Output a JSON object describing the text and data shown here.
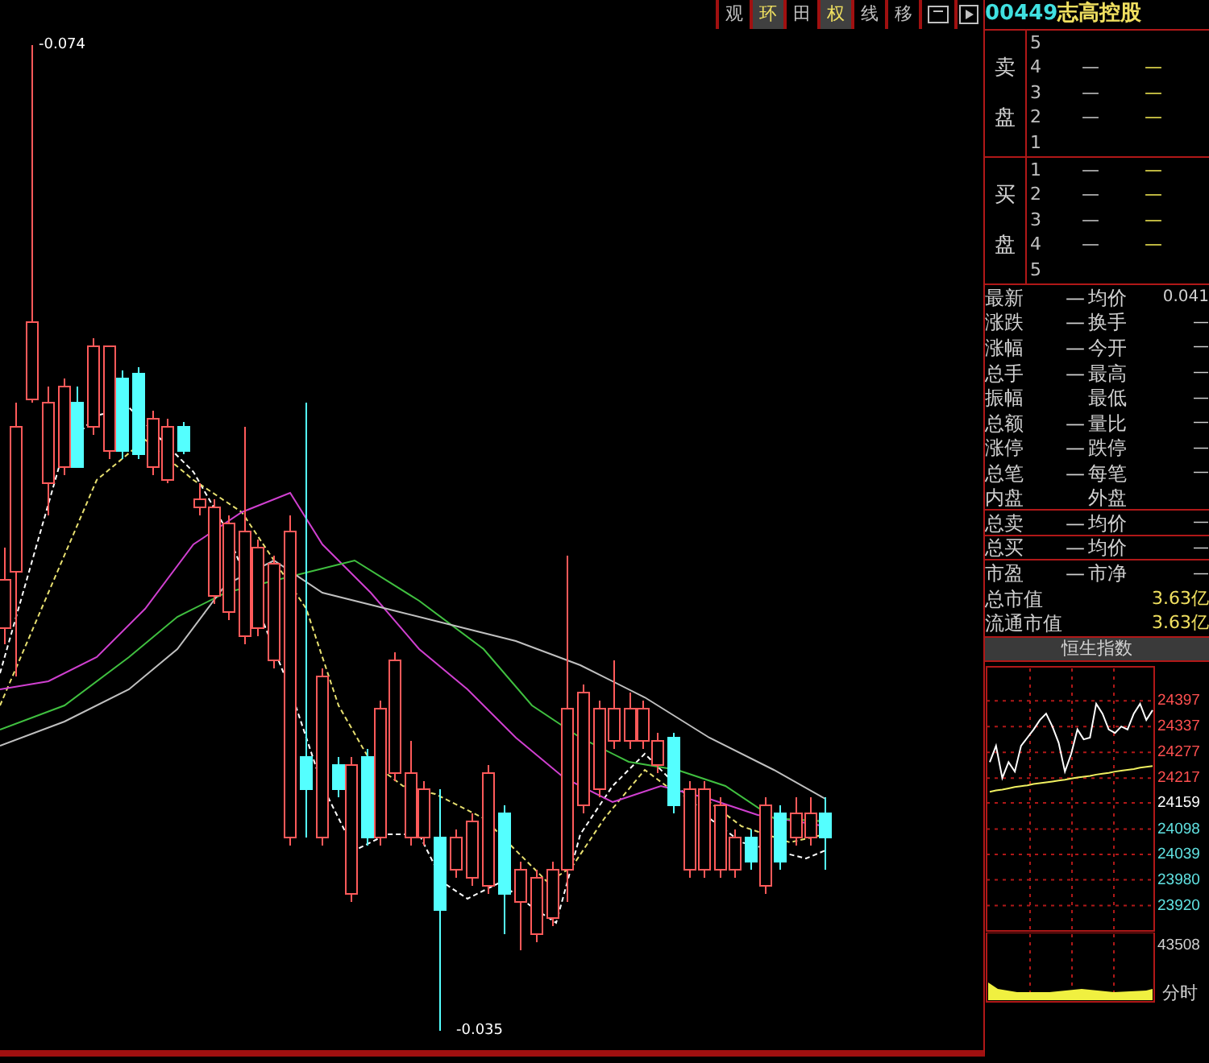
{
  "toolbar": {
    "buttons": [
      {
        "label": "观",
        "selected": false
      },
      {
        "label": "环",
        "selected": true
      },
      {
        "label": "田",
        "selected": false
      },
      {
        "label": "权",
        "selected": true
      },
      {
        "label": "线",
        "selected": false
      },
      {
        "label": "移",
        "selected": false
      }
    ]
  },
  "quote": {
    "code": "00449",
    "name": "志高控股"
  },
  "chart": {
    "high_label": "-0.074",
    "low_label": "-0.035"
  },
  "order_book": {
    "sell_label": [
      "卖",
      "盘"
    ],
    "buy_label": [
      "买",
      "盘"
    ],
    "sell": [
      {
        "level": "5"
      },
      {
        "level": "4",
        "price": "—",
        "volume": "—"
      },
      {
        "level": "3",
        "price": "—",
        "volume": "—"
      },
      {
        "level": "2",
        "price": "—",
        "volume": "—"
      },
      {
        "level": "1"
      }
    ],
    "buy": [
      {
        "level": "1",
        "price": "—",
        "volume": "—"
      },
      {
        "level": "2",
        "price": "—",
        "volume": "—"
      },
      {
        "level": "3",
        "price": "—",
        "volume": "—"
      },
      {
        "level": "4",
        "price": "—",
        "volume": "—"
      },
      {
        "level": "5"
      }
    ]
  },
  "stats": [
    {
      "label": "最新",
      "value": "—",
      "label_2": "均价",
      "value_2": "0.041",
      "divider": false
    },
    {
      "label": "涨跌",
      "value": "—",
      "label_2": "换手",
      "value_2": "—",
      "divider": false
    },
    {
      "label": "涨幅",
      "value": "—",
      "label_2": "今开",
      "value_2": "—",
      "divider": false
    },
    {
      "label": "总手",
      "value": "—",
      "label_2": "最高",
      "value_2": "—",
      "divider": false
    },
    {
      "label": "振幅",
      "label_2": "最低",
      "value_2": "—",
      "divider": false
    },
    {
      "label": "总额",
      "value": "—",
      "label_2": "量比",
      "value_2": "—",
      "divider": false
    },
    {
      "label": "涨停",
      "value": "—",
      "label_2": "跌停",
      "value_2": "—",
      "divider": false
    },
    {
      "label": "总笔",
      "value": "—",
      "label_2": "每笔",
      "value_2": "—",
      "divider": false
    },
    {
      "label": "内盘",
      "label_2": "外盘",
      "divider": true
    },
    {
      "label": "总卖",
      "value": "—",
      "label_2": "均价",
      "value_2": "—",
      "divider": true
    },
    {
      "label": "总买",
      "value": "—",
      "label_2": "均价",
      "value_2": "—",
      "divider": true
    },
    {
      "label": "市盈",
      "value": "—",
      "label_2": "市净",
      "value_2": "—",
      "divider": false
    }
  ],
  "market_cap": [
    {
      "label": "总市值",
      "value": "3.63亿"
    },
    {
      "label": "流通市值",
      "value": "3.63亿"
    }
  ],
  "index_panel": {
    "title": "恒生指数",
    "chart_data": {
      "type": "line",
      "ylim": [
        23861,
        24476
      ],
      "grid": true,
      "yticks": [
        24397,
        24337,
        24277,
        24217,
        24159,
        24098,
        24039,
        23980,
        23920
      ],
      "series": [
        {
          "color": "#ffffff",
          "values": [
            24254,
            24292,
            24217,
            24254,
            24232,
            24292,
            24311,
            24330,
            24352,
            24367,
            24337,
            24299,
            24232,
            24273,
            24330,
            24307,
            24311,
            24390,
            24367,
            24330,
            24322,
            24337,
            24330,
            24367,
            24390,
            24352,
            24375
          ]
        },
        {
          "color": "#f0f060",
          "values": [
            24185,
            24188,
            24190,
            24193,
            24196,
            24198,
            24200,
            24203,
            24205,
            24207,
            24209,
            24211,
            24213,
            24216,
            24218,
            24220,
            24222,
            24225,
            24227,
            24229,
            24232,
            24234,
            24236,
            24238,
            24241,
            24243,
            24245
          ]
        }
      ]
    },
    "volume_label": "43508",
    "time_label": "分时"
  }
}
